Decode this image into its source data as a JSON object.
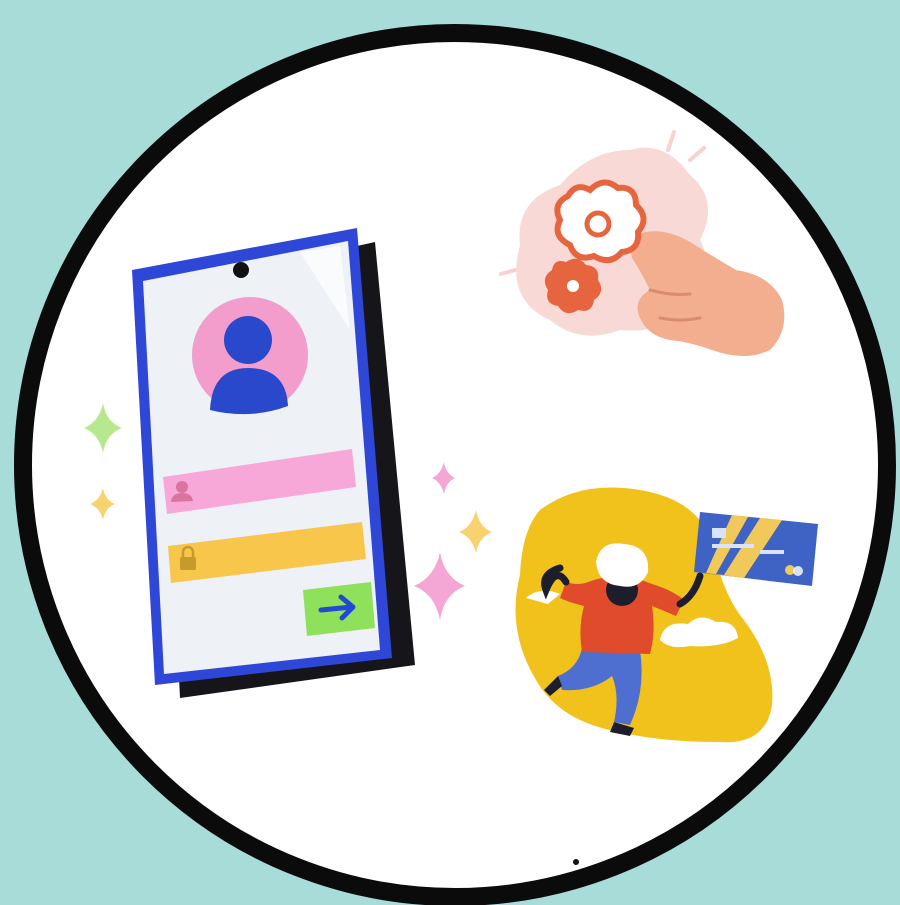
{
  "colors": {
    "background": "#a7dcd8",
    "circle_fill": "#ffffff",
    "circle_stroke": "#0b0b0b",
    "phone_frame": "#2f47d6",
    "phone_shadow": "#16161a",
    "screen": "#eef1f6",
    "avatar_bg": "#f29dcb",
    "avatar_figure": "#2948cc",
    "username_field": "#f7a8d8",
    "password_field": "#f7c64a",
    "submit_button": "#8fe05a",
    "submit_arrow": "#2447d4",
    "sparkle_green": "#b7e88d",
    "sparkle_yellow": "#f7d26e",
    "sparkle_pink": "#f4a6d4",
    "flower_outline": "#e6653f",
    "flower_splash": "#f7d2cf",
    "hand": "#f2ae8e",
    "blob_yellow": "#f2c21c",
    "person_shirt": "#e04b2b",
    "person_pants": "#4e6fcf",
    "card_blue": "#3e63c4",
    "card_stripe": "#f0c95a"
  },
  "phone": {
    "username_icon": "user-icon",
    "password_icon": "lock-icon",
    "submit_icon": "arrow-right-icon"
  },
  "illustrations": {
    "top_right": "hand-with-flowers",
    "bottom_right": "person-holding-credit-card"
  }
}
